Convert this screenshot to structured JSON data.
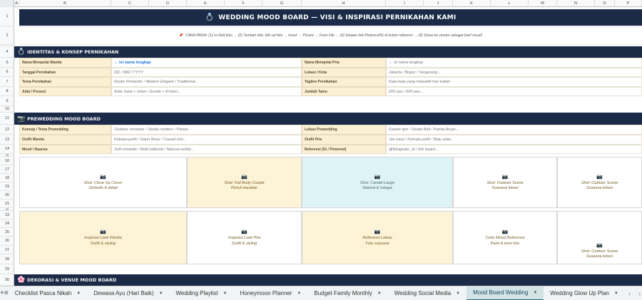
{
  "columns": [
    "A",
    "B",
    "C",
    "D",
    "E",
    "F",
    "G",
    "H",
    "I",
    "J",
    "K",
    "L",
    "M",
    "N",
    "O",
    "P"
  ],
  "rows": [
    "1",
    "2",
    "3",
    "4",
    "5",
    "6",
    "7",
    "8",
    "9",
    "10",
    "11",
    "12",
    "13",
    "14",
    "15",
    "16",
    "17",
    "18",
    "19",
    "20",
    "21",
    "22",
    "23",
    "24",
    "25",
    "26",
    "27",
    "28",
    "29",
    "30"
  ],
  "title": {
    "icon": "diamond-ring-icon",
    "text": "WEDDING MOOD BOARD — VISI & INSPIRASI PERNIKAHAN KAMI"
  },
  "instructions": "CARA PAKAI: (1) Isi field teks → (2) Tambah foto: klik sel foto → Insert → Picture → From File → (3) Simpan link Pinterest/IG di kolom referensi → (4) Share ke vendor sebagai brief visual!",
  "section1": {
    "title": "IDENTITAS & KONSEP PERNIKAHAN",
    "icon": "ring-icon",
    "left": [
      {
        "label": "Nama Mempelai Wanita",
        "value": "← isi nama lengkap"
      },
      {
        "label": "Tanggal Pernikahan",
        "value": "DD / MM / YYYY"
      },
      {
        "label": "Tema Pernikahan",
        "value": "Rustic Romantic / Modern Elegant / Traditional..."
      },
      {
        "label": "Adat / Prosesi",
        "value": "Adat Jawa + Islam / Sunda + Kristen..."
      }
    ],
    "right": [
      {
        "label": "Nama Mempelai Pria",
        "value": "← isi nama lengkap"
      },
      {
        "label": "Lokasi / Kota",
        "value": "Jakarta / Bogor / Tangerang..."
      },
      {
        "label": "Tagline Pernikahan",
        "value": "Kata-kata yang mewakili hari kalian"
      },
      {
        "label": "Jumlah Tamu",
        "value": "200 pax / 500 pax..."
      }
    ]
  },
  "section2": {
    "title": "PREWEDDING MOOD BOARD",
    "icon": "camera-icon",
    "left": [
      {
        "label": "Konsep / Tema Prewedding",
        "value": "Outdoor romantic / Studio modern / Pantai..."
      },
      {
        "label": "Outfit Wanita",
        "value": "Kebaya putih / Gaun flowy / Casual chic..."
      },
      {
        "label": "Mood / Nuansa",
        "value": "Soft romantic / Bold editorial / Natural earthy..."
      }
    ],
    "right": [
      {
        "label": "Lokasi Prewedding",
        "value": "Kawah Ijen / Studio Bali / Pantai Anyer..."
      },
      {
        "label": "Outfit Pria",
        "value": "Jas navy / Kemeja putih / Baju adat..."
      },
      {
        "label": "Referensi (IG / Pinterest)",
        "value": "@fotografer_id / link board..."
      }
    ]
  },
  "tiles_row1": [
    {
      "line1": "Shot: Close Up Cincin",
      "line2": "Simbolis & detail"
    },
    {
      "line1": "Shot: Full Body Couple",
      "line2": "Penuh karakter"
    },
    {
      "line1": "Shot: Candid Laugh",
      "line2": "Natural & hangat"
    },
    {
      "line1": "Shot: Outdoor Scene",
      "line2": "Suasana lokasi"
    },
    {
      "line1": "Shot: Outdoor Scene",
      "line2": "Suasana lokasi"
    }
  ],
  "tiles_row2": [
    {
      "line1": "Inspirasi Look Wanita",
      "line2": "Outfit & styling"
    },
    {
      "line1": "Inspirasi Look Pria",
      "line2": "Outfit & styling"
    },
    {
      "line1": "Referensi Lokasi",
      "line2": "Foto suasana"
    },
    {
      "line1": "Color Mood Reference",
      "line2": "Palet & tone foto"
    },
    {
      "line1": "Shot: Outdoor Scene",
      "line2": "Suasana lokasi"
    }
  ],
  "tile_icon": "camera-icon",
  "section3": {
    "title": "DEKORASI & VENUE MOOD BOARD",
    "icon": "flower-icon"
  },
  "tabs": [
    "Checklist Pasca Nikah",
    "Dewasa Ayu (Hari Baik)",
    "Wedding Playlist",
    "Honeymoon Planner",
    "Budget Family Monthly",
    "Wedding Social Media",
    "Mood Board Wedding",
    "Wedding Glow Up Plan"
  ],
  "active_tab": "Mood Board Wedding",
  "colors": {
    "header": "#1b2a46",
    "label_bg": "#fbf0d4",
    "tile_yellow": "#fdf3d6",
    "tile_blue": "#def3f6",
    "active_tab": "#d3e3e6"
  }
}
